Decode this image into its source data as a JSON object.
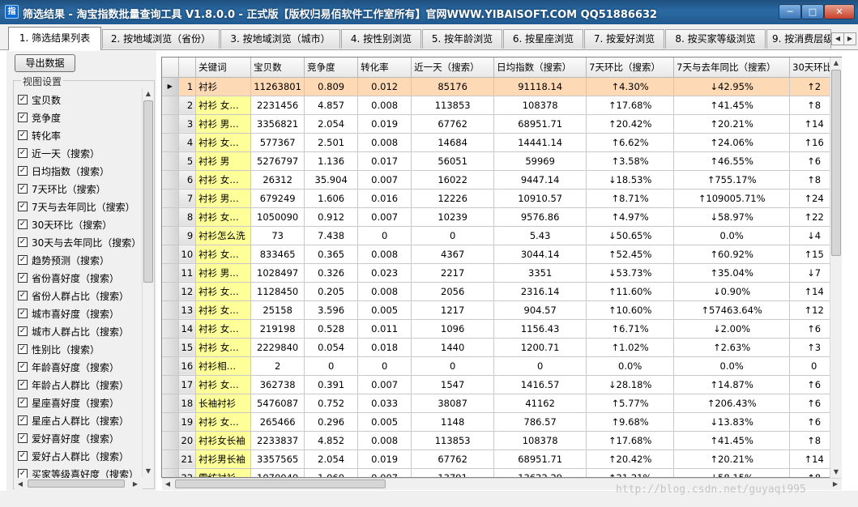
{
  "window": {
    "title": "筛选结果 - 淘宝指数批量查询工具 V1.8.0.0 - 正式版【版权归易佰软件工作室所有】官网WWW.YIBAISOFT.COM QQ51886632",
    "icon_letter": "指",
    "min_label": "─",
    "max_label": "□",
    "close_label": "✕"
  },
  "tabs": [
    {
      "label": "1. 筛选结果列表"
    },
    {
      "label": "2. 按地域浏览（省份）"
    },
    {
      "label": "3. 按地域浏览（城市）"
    },
    {
      "label": "4. 按性别浏览"
    },
    {
      "label": "5. 按年龄浏览"
    },
    {
      "label": "6. 按星座浏览"
    },
    {
      "label": "7. 按爱好浏览"
    },
    {
      "label": "8. 按买家等级浏览"
    },
    {
      "label": "9. 按消费层级浏览"
    }
  ],
  "left_panel": {
    "export_label": "导出数据",
    "group_label": "视图设置",
    "options": [
      {
        "label": "宝贝数",
        "checked": true
      },
      {
        "label": "竞争度",
        "checked": true
      },
      {
        "label": "转化率",
        "checked": true
      },
      {
        "label": "近一天（搜索）",
        "checked": true
      },
      {
        "label": "日均指数（搜索）",
        "checked": true
      },
      {
        "label": "7天环比（搜索）",
        "checked": true
      },
      {
        "label": "7天与去年同比（搜索）",
        "checked": true
      },
      {
        "label": "30天环比（搜索）",
        "checked": true
      },
      {
        "label": "30天与去年同比（搜索）",
        "checked": true
      },
      {
        "label": "趋势预测（搜索）",
        "checked": true
      },
      {
        "label": "省份喜好度（搜索）",
        "checked": true
      },
      {
        "label": "省份人群占比（搜索）",
        "checked": true
      },
      {
        "label": "城市喜好度（搜索）",
        "checked": true
      },
      {
        "label": "城市人群占比（搜索）",
        "checked": true
      },
      {
        "label": "性别比（搜索）",
        "checked": true
      },
      {
        "label": "年龄喜好度（搜索）",
        "checked": true
      },
      {
        "label": "年龄占人群比（搜索）",
        "checked": true
      },
      {
        "label": "星座喜好度（搜索）",
        "checked": true
      },
      {
        "label": "星座占人群比（搜索）",
        "checked": true
      },
      {
        "label": "爱好喜好度（搜索）",
        "checked": true
      },
      {
        "label": "爱好占人群比（搜索）",
        "checked": true
      },
      {
        "label": "买家等级喜好度（搜索）",
        "checked": true
      }
    ]
  },
  "grid": {
    "columns": [
      "关键词",
      "宝贝数",
      "竞争度",
      "转化率",
      "近一天（搜索）",
      "日均指数（搜索）",
      "7天环比（搜索）",
      "7天与去年同比（搜索）",
      "30天环比"
    ],
    "current_row_marker": "▶",
    "rows": [
      {
        "idx": "1",
        "kw": "衬衫",
        "items": "11263801",
        "comp": "0.809",
        "conv": "0.012",
        "day": "85176",
        "avg": "91118.14",
        "w7": "↑4.30%",
        "y7": "↓42.95%",
        "m30": "↑2"
      },
      {
        "idx": "2",
        "kw": "衬衫 女…",
        "items": "2231456",
        "comp": "4.857",
        "conv": "0.008",
        "day": "113853",
        "avg": "108378",
        "w7": "↑17.68%",
        "y7": "↑41.45%",
        "m30": "↑8"
      },
      {
        "idx": "3",
        "kw": "衬衫 男…",
        "items": "3356821",
        "comp": "2.054",
        "conv": "0.019",
        "day": "67762",
        "avg": "68951.71",
        "w7": "↑20.42%",
        "y7": "↑20.21%",
        "m30": "↑14"
      },
      {
        "idx": "4",
        "kw": "衬衫 女…",
        "items": "577367",
        "comp": "2.501",
        "conv": "0.008",
        "day": "14684",
        "avg": "14441.14",
        "w7": "↑6.62%",
        "y7": "↑24.06%",
        "m30": "↑16"
      },
      {
        "idx": "5",
        "kw": "衬衫 男",
        "items": "5276797",
        "comp": "1.136",
        "conv": "0.017",
        "day": "56051",
        "avg": "59969",
        "w7": "↑3.58%",
        "y7": "↑46.55%",
        "m30": "↑6"
      },
      {
        "idx": "6",
        "kw": "衬衫 女…",
        "items": "26312",
        "comp": "35.904",
        "conv": "0.007",
        "day": "16022",
        "avg": "9447.14",
        "w7": "↓18.53%",
        "y7": "↑755.17%",
        "m30": "↑8"
      },
      {
        "idx": "7",
        "kw": "衬衫 男…",
        "items": "679249",
        "comp": "1.606",
        "conv": "0.016",
        "day": "12226",
        "avg": "10910.57",
        "w7": "↑8.71%",
        "y7": "↑109005.71%",
        "m30": "↑24"
      },
      {
        "idx": "8",
        "kw": "衬衫 女…",
        "items": "1050090",
        "comp": "0.912",
        "conv": "0.007",
        "day": "10239",
        "avg": "9576.86",
        "w7": "↑4.97%",
        "y7": "↓58.97%",
        "m30": "↑22"
      },
      {
        "idx": "9",
        "kw": "衬衫怎么洗",
        "items": "73",
        "comp": "7.438",
        "conv": "0",
        "day": "0",
        "avg": "5.43",
        "w7": "↓50.65%",
        "y7": "0.0%",
        "m30": "↓4"
      },
      {
        "idx": "10",
        "kw": "衬衫 女…",
        "items": "833465",
        "comp": "0.365",
        "conv": "0.008",
        "day": "4367",
        "avg": "3044.14",
        "w7": "↑52.45%",
        "y7": "↑60.92%",
        "m30": "↑15"
      },
      {
        "idx": "11",
        "kw": "衬衫 男…",
        "items": "1028497",
        "comp": "0.326",
        "conv": "0.023",
        "day": "2217",
        "avg": "3351",
        "w7": "↓53.73%",
        "y7": "↑35.04%",
        "m30": "↓7"
      },
      {
        "idx": "12",
        "kw": "衬衫 女…",
        "items": "1128450",
        "comp": "0.205",
        "conv": "0.008",
        "day": "2056",
        "avg": "2316.14",
        "w7": "↑11.60%",
        "y7": "↓0.90%",
        "m30": "↑14"
      },
      {
        "idx": "13",
        "kw": "衬衫 女…",
        "items": "25158",
        "comp": "3.596",
        "conv": "0.005",
        "day": "1217",
        "avg": "904.57",
        "w7": "↑10.60%",
        "y7": "↑57463.64%",
        "m30": "↑12"
      },
      {
        "idx": "14",
        "kw": "衬衫 女…",
        "items": "219198",
        "comp": "0.528",
        "conv": "0.011",
        "day": "1096",
        "avg": "1156.43",
        "w7": "↑6.71%",
        "y7": "↓2.00%",
        "m30": "↑6"
      },
      {
        "idx": "15",
        "kw": "衬衫 女…",
        "items": "2229840",
        "comp": "0.054",
        "conv": "0.018",
        "day": "1440",
        "avg": "1200.71",
        "w7": "↑1.02%",
        "y7": "↑2.63%",
        "m30": "↑3"
      },
      {
        "idx": "16",
        "kw": "衬衫相…",
        "items": "2",
        "comp": "0",
        "conv": "0",
        "day": "0",
        "avg": "0",
        "w7": "0.0%",
        "y7": "0.0%",
        "m30": "0"
      },
      {
        "idx": "17",
        "kw": "衬衫 女…",
        "items": "362738",
        "comp": "0.391",
        "conv": "0.007",
        "day": "1547",
        "avg": "1416.57",
        "w7": "↓28.18%",
        "y7": "↑14.87%",
        "m30": "↑6"
      },
      {
        "idx": "18",
        "kw": "长袖衬衫",
        "items": "5476087",
        "comp": "0.752",
        "conv": "0.033",
        "day": "38087",
        "avg": "41162",
        "w7": "↑5.77%",
        "y7": "↑206.43%",
        "m30": "↑6"
      },
      {
        "idx": "19",
        "kw": "衬衫 女…",
        "items": "265466",
        "comp": "0.296",
        "conv": "0.005",
        "day": "1148",
        "avg": "786.57",
        "w7": "↑9.68%",
        "y7": "↓13.83%",
        "m30": "↑6"
      },
      {
        "idx": "20",
        "kw": "衬衫女长袖",
        "items": "2233837",
        "comp": "4.852",
        "conv": "0.008",
        "day": "113853",
        "avg": "108378",
        "w7": "↑17.68%",
        "y7": "↑41.45%",
        "m30": "↑8"
      },
      {
        "idx": "21",
        "kw": "衬衫男长袖",
        "items": "3357565",
        "comp": "2.054",
        "conv": "0.019",
        "day": "67762",
        "avg": "68951.71",
        "w7": "↑20.42%",
        "y7": "↑20.21%",
        "m30": "↑14"
      },
      {
        "idx": "22",
        "kw": "雪纺衬衫",
        "items": "1070040",
        "comp": "1.060",
        "conv": "0.007",
        "day": "13791",
        "avg": "13622.29",
        "w7": "↑21.21%",
        "y7": "↓58.15%",
        "m30": "↑8"
      }
    ]
  },
  "watermark": "http://blog.csdn.net/guyaqi995"
}
